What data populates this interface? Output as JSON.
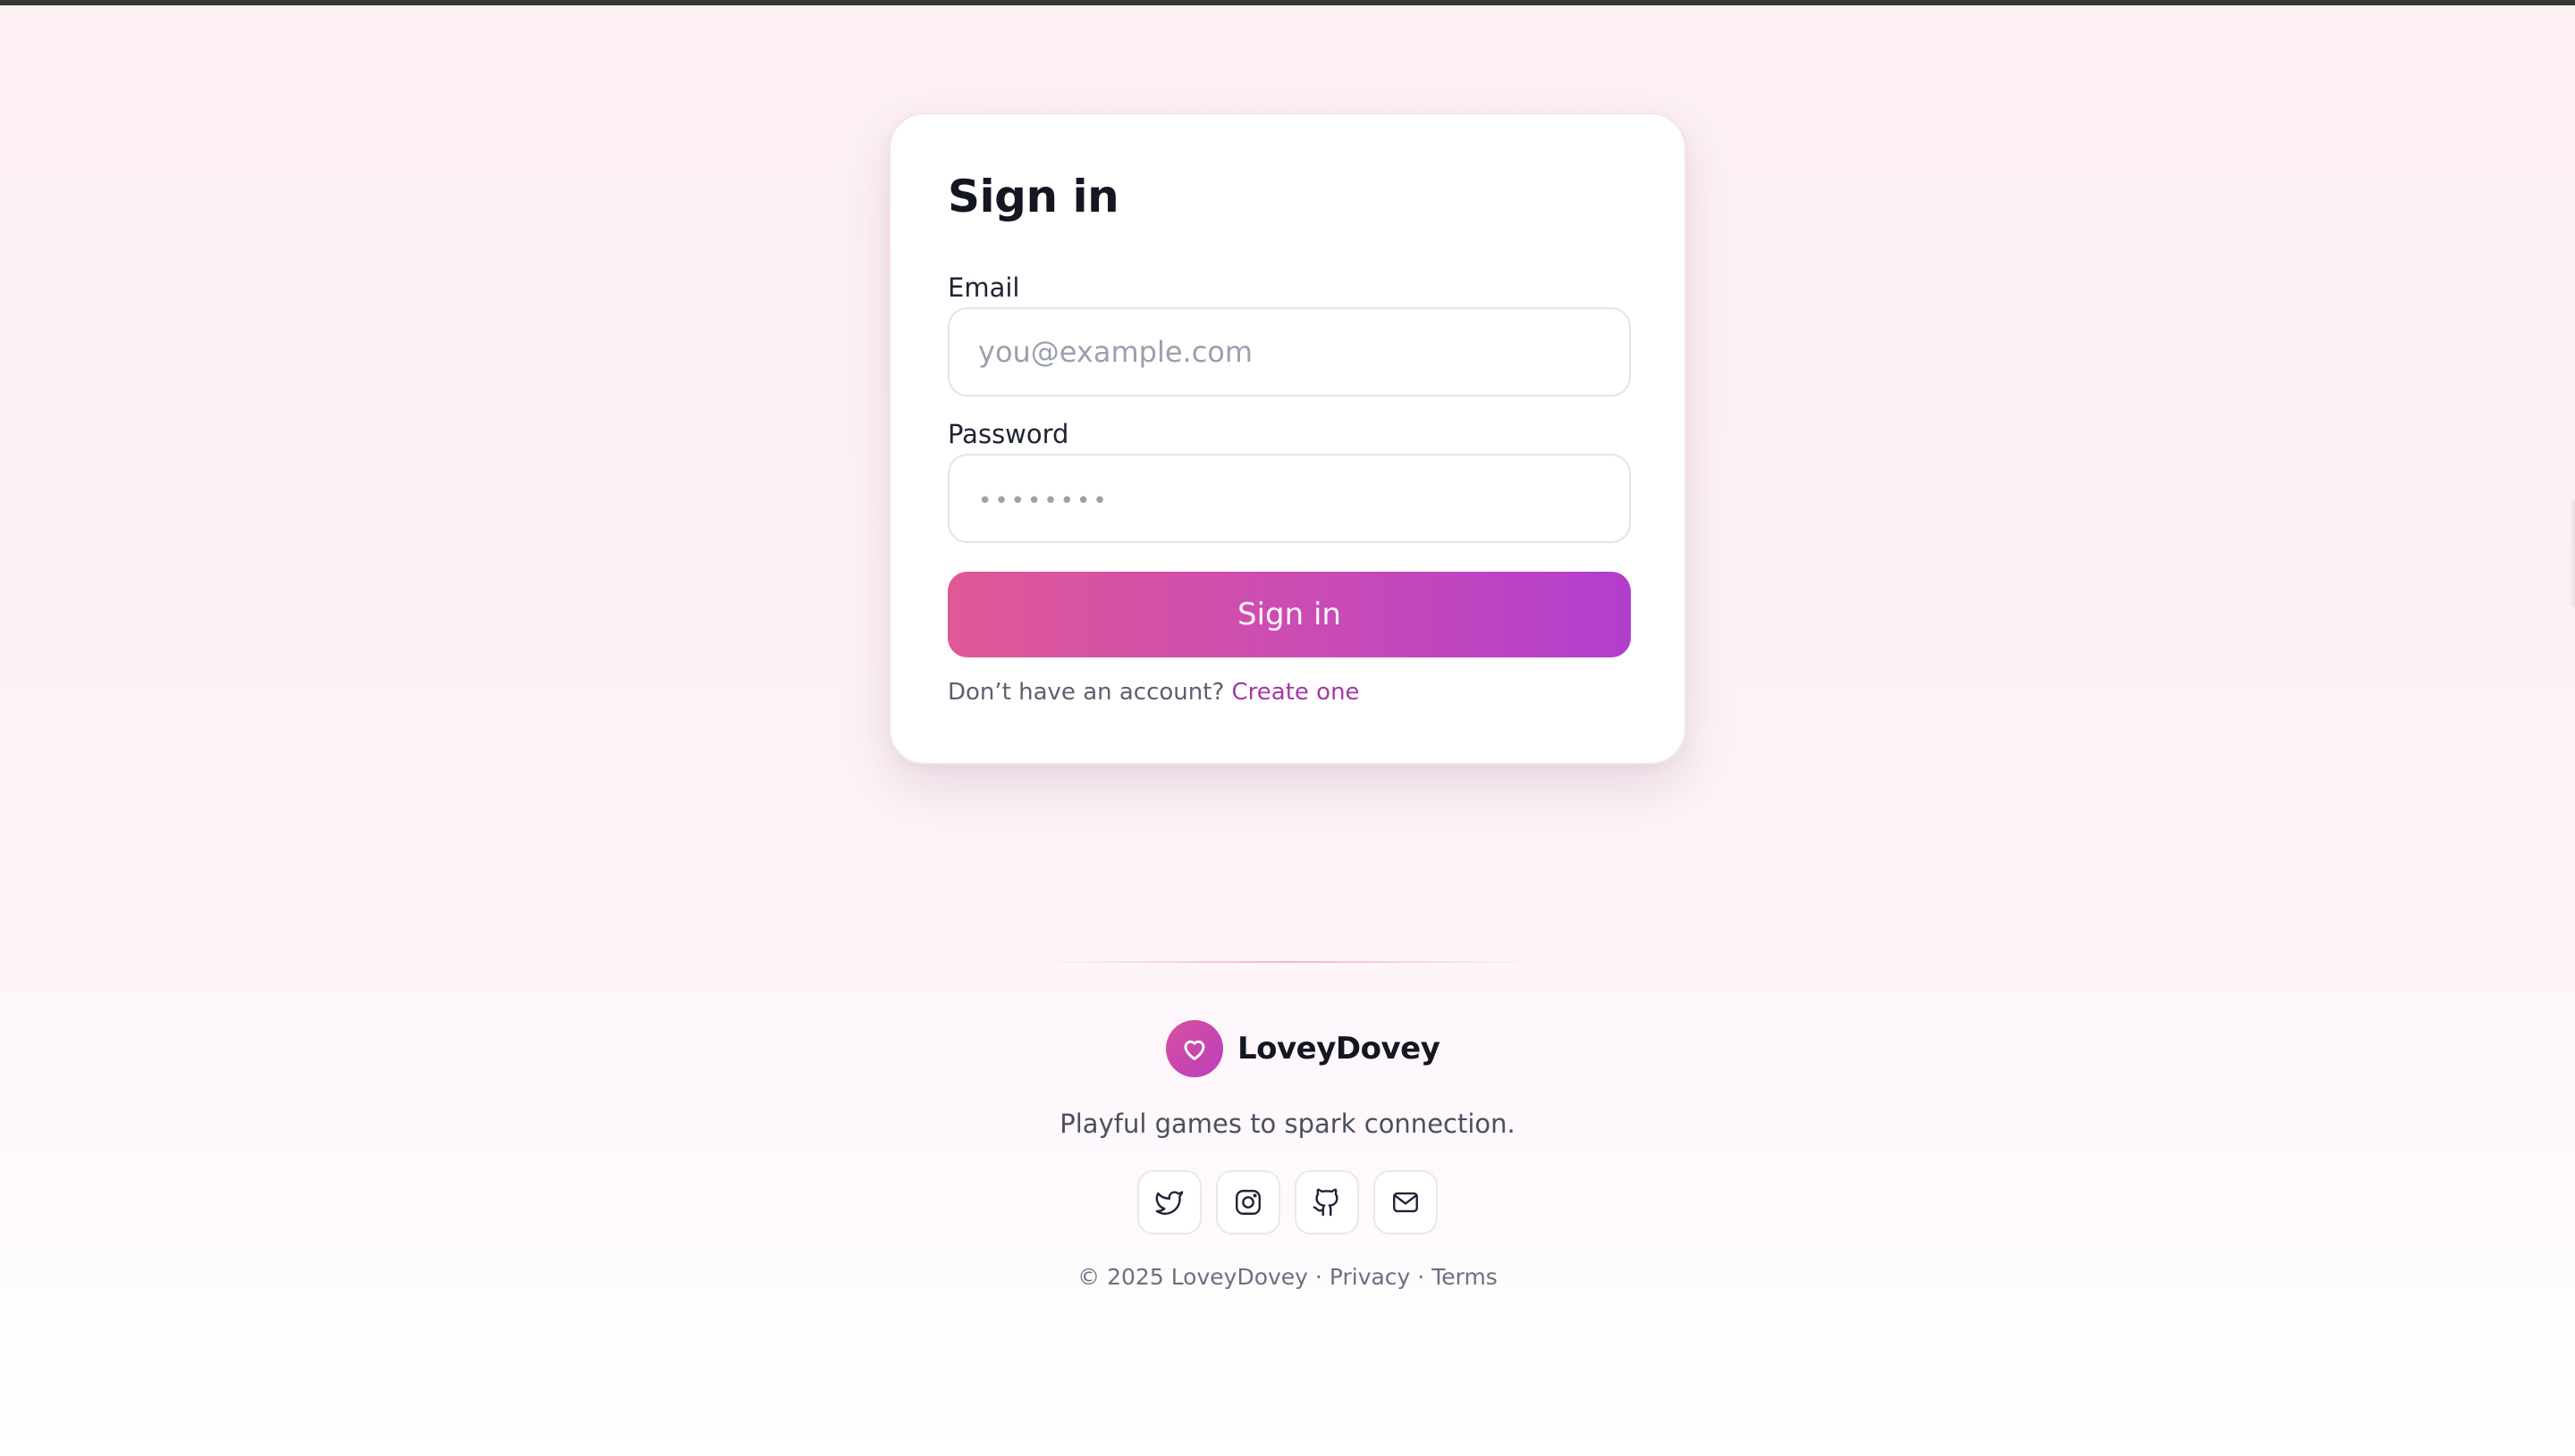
{
  "signin": {
    "title": "Sign in",
    "email_label": "Email",
    "email_placeholder": "you@example.com",
    "password_label": "Password",
    "password_placeholder": "••••••••",
    "submit_label": "Sign in",
    "signup_prompt": "Don’t have an account?",
    "signup_link": "Create one"
  },
  "footer": {
    "brand_name": "LoveyDovey",
    "tagline": "Playful games to spark connection.",
    "socials": [
      {
        "name": "twitter",
        "icon": "twitter-icon"
      },
      {
        "name": "instagram",
        "icon": "instagram-icon"
      },
      {
        "name": "github",
        "icon": "github-icon"
      },
      {
        "name": "email",
        "icon": "mail-icon"
      }
    ],
    "copyright": "© 2025 LoveyDovey",
    "separator": "·",
    "privacy": "Privacy",
    "terms": "Terms"
  },
  "colors": {
    "accent_start": "#e05896",
    "accent_end": "#b23ecd",
    "link": "#a33aa6",
    "background": "#fcf0f2"
  }
}
